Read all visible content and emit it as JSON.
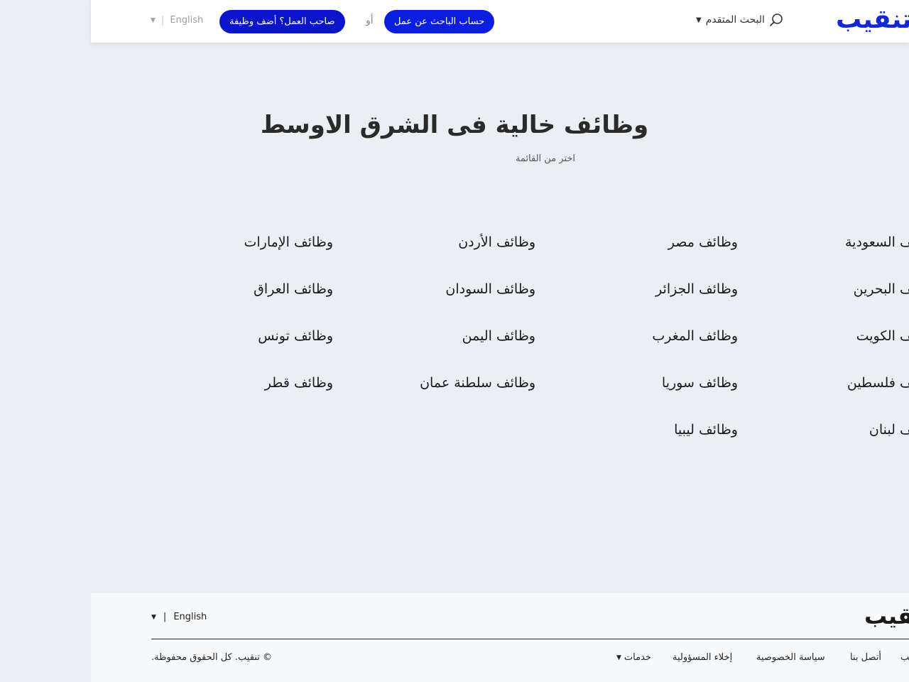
{
  "header": {
    "logo_text": "تنقيب",
    "advanced_search_label": "البحث المتقدم",
    "seeker_button_label": "حساب الباحث عن عمل",
    "or_text": "أو",
    "employer_button_label": "صاحب العمل؟ أضف وظيفة",
    "language_label": "English",
    "separator": "|"
  },
  "main": {
    "title": "وظائف خالية فى الشرق الاوسط",
    "subtitle": "اختر من القائمة",
    "countries": {
      "col_a": [
        "وظائف مصر",
        "وظائف الجزائر",
        "وظائف المغرب",
        "وظائف سوريا",
        "وظائف ليبيا"
      ],
      "col_b": [
        "وظائف الأردن",
        "وظائف السودان",
        "وظائف اليمن",
        "وظائف سلطنة عمان"
      ],
      "col_c": [
        "وظائف الإمارات",
        "وظائف العراق",
        "وظائف تونس",
        "وظائف قطر"
      ],
      "col_d": [
        "وظائف السعودية",
        "وظائف البحرين",
        "وظائف الكويت",
        "وظائف فلسطين",
        "وظائف لبنان"
      ]
    }
  },
  "footer": {
    "logo_text": "تنقيب",
    "language_label": "English",
    "separator": "|",
    "links": {
      "about": "عن تنقيب",
      "contact": "أتصل بنا",
      "privacy": "سياسة الخصوصية",
      "disclaimer": "إخلاء المسؤولية",
      "services": "خدمات"
    },
    "copyright": "© تنقيب. كل الحقوق محفوظة."
  }
}
